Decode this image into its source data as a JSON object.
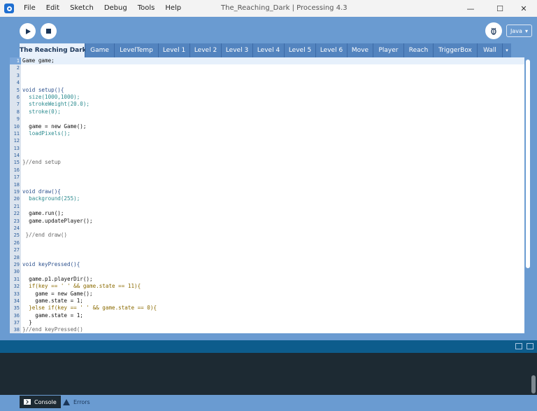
{
  "window": {
    "title": "The_Reaching_Dark | Processing 4.3",
    "controls": {
      "minimize": "—",
      "maximize": "☐",
      "close": "✕"
    }
  },
  "menu": [
    "File",
    "Edit",
    "Sketch",
    "Debug",
    "Tools",
    "Help"
  ],
  "toolbar": {
    "run_icon": "play-icon",
    "stop_icon": "stop-icon",
    "debug_icon": "debugger-icon",
    "mode": "Java",
    "mode_caret": "▾"
  },
  "tabs": [
    {
      "label": "The Reaching Dark",
      "active": true
    },
    {
      "label": "Game"
    },
    {
      "label": "LevelTemp"
    },
    {
      "label": "Level 1"
    },
    {
      "label": "Level 2"
    },
    {
      "label": "Level 3"
    },
    {
      "label": "Level 4"
    },
    {
      "label": "Level 5"
    },
    {
      "label": "Level 6"
    },
    {
      "label": "Move"
    },
    {
      "label": "Player"
    },
    {
      "label": "Reach"
    },
    {
      "label": "TriggerBox"
    },
    {
      "label": "Wall"
    }
  ],
  "tab_more": "▾",
  "code_lines": [
    "Game game;",
    "",
    "",
    "",
    "void setup(){",
    "  size(1000,1000);",
    "  strokeWeight(20.0);",
    "  stroke(0);",
    "",
    "  game = new Game();",
    "  loadPixels();",
    "",
    "",
    "",
    "}//end setup",
    "",
    "",
    "",
    "void draw(){",
    "  background(255);",
    "",
    "  game.run();",
    "  game.updatePlayer();",
    "",
    " }//end draw()",
    "",
    "",
    "",
    "void keyPressed(){",
    "",
    "  game.p1.playerDir();",
    "  if(key == ' ' && game.state == 11){",
    "    game = new Game();",
    "    game.state = 1;",
    "  }else if(key == ' ' && game.state == 0){",
    "    game.state = 1;",
    "  }",
    "}//end keyPressed()"
  ],
  "colors": {
    "accent": "#6a9bd1",
    "tab_inactive": "#5384bf",
    "message_bar": "#0d5c8c",
    "console_bg": "#1d2a33"
  },
  "bottom_tabs": {
    "console": "Console",
    "errors": "Errors"
  }
}
